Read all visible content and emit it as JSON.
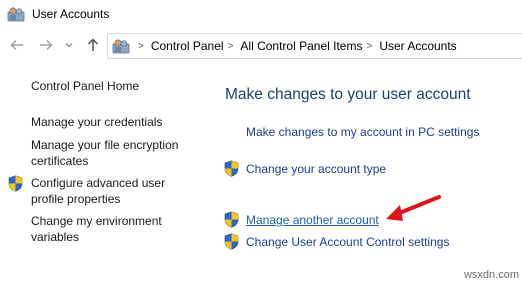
{
  "window": {
    "title": "User Accounts"
  },
  "nav": {
    "back_icon": "arrow-left-icon",
    "forward_icon": "arrow-right-icon",
    "recent_icon": "chevron-down-icon",
    "up_icon": "arrow-up-icon"
  },
  "address": {
    "crumbs": [
      "Control Panel",
      "All Control Panel Items",
      "User Accounts"
    ]
  },
  "sidebar": {
    "home": "Control Panel Home",
    "credentials": "Manage your credentials",
    "encryption_line1": "Manage your file encryption",
    "encryption_line2": "certificates",
    "advanced_line1": "Configure advanced user",
    "advanced_line2": "profile properties",
    "environment_line1": "Change my environment",
    "environment_line2": "variables"
  },
  "main": {
    "heading": "Make changes to your user account",
    "pc_settings_link": "Make changes to my account in PC settings",
    "account_type_link": "Change your account type",
    "manage_another_link": "Manage another account",
    "uac_link": "Change User Account Control settings"
  },
  "colors": {
    "link": "#1a3f8f",
    "heading": "#1e3f73",
    "annotation_arrow": "#e0141c"
  },
  "watermark": "wsxdn.com"
}
